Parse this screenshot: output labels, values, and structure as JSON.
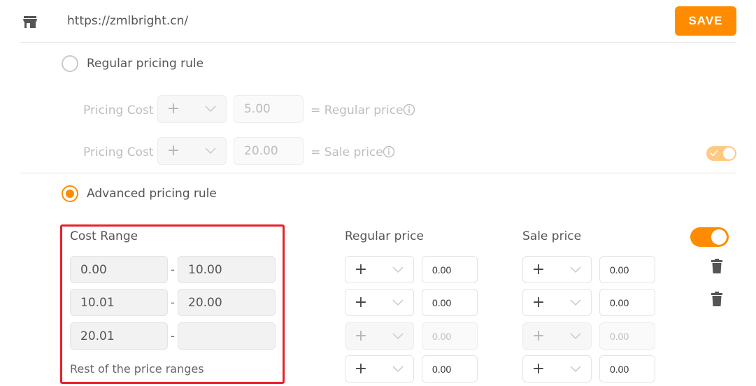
{
  "header": {
    "url": "https://zmlbright.cn/",
    "save_label": "SAVE",
    "store_icon": "store-icon"
  },
  "regular_rule": {
    "label": "Regular pricing rule",
    "selected": false,
    "rows": [
      {
        "label": "Pricing Cost",
        "operator": "+",
        "value": "5.00",
        "result": "= Regular price"
      },
      {
        "label": "Pricing Cost",
        "operator": "+",
        "value": "20.00",
        "result": "= Sale price"
      }
    ],
    "toggle_on": true
  },
  "advanced_rule": {
    "label": "Advanced pricing rule",
    "selected": true,
    "headers": {
      "cost_range": "Cost Range",
      "regular": "Regular price",
      "sale": "Sale price"
    },
    "toggle_on": true,
    "rows": [
      {
        "from": "0.00",
        "to": "10.00",
        "reg_op": "+",
        "reg_val": "0.00",
        "sale_op": "+",
        "sale_val": "0.00"
      },
      {
        "from": "10.01",
        "to": "20.00",
        "reg_op": "+",
        "reg_val": "0.00",
        "sale_op": "+",
        "sale_val": "0.00"
      },
      {
        "from": "20.01",
        "to": "",
        "reg_op": "+",
        "reg_val": "0.00",
        "sale_op": "+",
        "sale_val": "0.00"
      }
    ],
    "rest": {
      "label": "Rest of the price ranges",
      "reg_op": "+",
      "reg_val": "0.00",
      "sale_op": "+",
      "sale_val": "0.00"
    },
    "dash": "-"
  },
  "colors": {
    "accent": "#ff8c00",
    "highlight": "#e8202a"
  }
}
